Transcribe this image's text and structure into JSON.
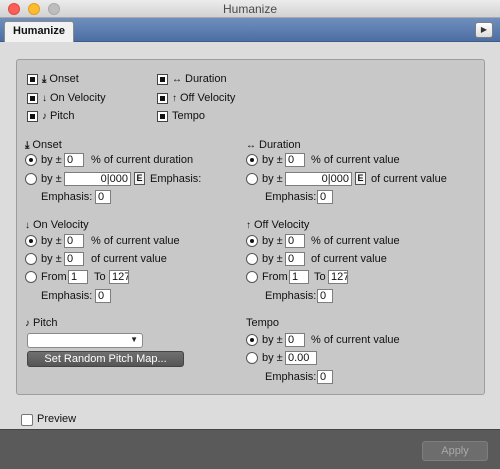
{
  "window": {
    "title": "Humanize"
  },
  "tab": {
    "label": "Humanize"
  },
  "checks": [
    {
      "icon": "⤓",
      "label": "Onset",
      "checked": true
    },
    {
      "icon": "↓",
      "label": "On Velocity",
      "checked": true
    },
    {
      "icon": "♪",
      "label": "Pitch",
      "checked": true
    },
    {
      "icon": "↔",
      "label": "Duration",
      "checked": true
    },
    {
      "icon": "↑",
      "label": "Off Velocity",
      "checked": true
    },
    {
      "icon": "",
      "label": "Tempo",
      "checked": true
    }
  ],
  "onset": {
    "title": "Onset",
    "by_label": "by ±",
    "by_value": "0",
    "pct_label": "% of current duration",
    "by2_label": "by ±",
    "by2_value": "0|000",
    "e_label": "E",
    "emphasis_inline": "Emphasis:",
    "emphasis_label": "Emphasis:",
    "emphasis_value": "0"
  },
  "duration": {
    "title": "Duration",
    "by_label": "by ±",
    "by_value": "0",
    "pct_label": "% of current value",
    "by2_label": "by ±",
    "by2_value": "0|000",
    "e_label": "E",
    "of_label": "of current value",
    "emphasis_label": "Emphasis:",
    "emphasis_value": "0"
  },
  "on_velocity": {
    "title": "On Velocity",
    "by_label": "by ±",
    "by_value": "0",
    "pct_label": "% of current value",
    "by2_label": "by ±",
    "by2_value": "0",
    "of_label": "of current value",
    "from_label": "From",
    "from_value": "1",
    "to_label": "To",
    "to_value": "127",
    "emphasis_label": "Emphasis:",
    "emphasis_value": "0"
  },
  "off_velocity": {
    "title": "Off Velocity",
    "by_label": "by ±",
    "by_value": "0",
    "pct_label": "% of current value",
    "by2_label": "by ±",
    "by2_value": "0",
    "of_label": "of current value",
    "from_label": "From",
    "from_value": "1",
    "to_label": "To",
    "to_value": "127",
    "emphasis_label": "Emphasis:",
    "emphasis_value": "0"
  },
  "pitch": {
    "title": "Pitch",
    "dropdown_value": "",
    "map_button": "Set Random Pitch Map..."
  },
  "tempo": {
    "title": "Tempo",
    "by_label": "by ±",
    "by_value": "0",
    "pct_label": "% of current value",
    "by2_label": "by ±",
    "by2_value": "0.00",
    "emphasis_label": "Emphasis:",
    "emphasis_value": "0"
  },
  "preview": {
    "label": "Preview",
    "checked": false
  },
  "footer": {
    "apply_label": "Apply"
  }
}
